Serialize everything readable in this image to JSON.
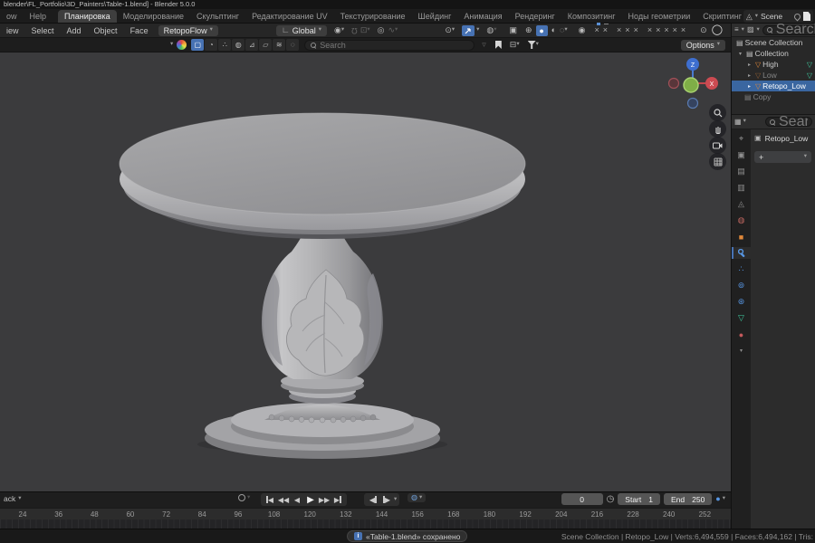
{
  "titlebar": {
    "title": "blender\\FL_Portfolio\\3D_Painters\\Table-1.blend] - Blender 5.0.0"
  },
  "menubar": {
    "window_menu": "ow",
    "help_menu": "Help",
    "tabs": [
      {
        "label": "Планировка"
      },
      {
        "label": "Моделирование"
      },
      {
        "label": "Скульптинг"
      },
      {
        "label": "Редактирование UV"
      },
      {
        "label": "Текстурирование"
      },
      {
        "label": "Шейдинг"
      },
      {
        "label": "Анимация"
      },
      {
        "label": "Рендеринг"
      },
      {
        "label": "Композитинг"
      },
      {
        "label": "Ноды геометрии"
      },
      {
        "label": "Скриптинг"
      },
      {
        "label": "+"
      }
    ],
    "scene_name": "Scene"
  },
  "toolbar": {
    "menus": [
      "iew",
      "Select",
      "Add",
      "Object",
      "Face"
    ],
    "active_tool": "RetopoFlow",
    "orientation": "Global"
  },
  "viewport": {
    "search_placeholder": "Search",
    "options_label": "Options",
    "axis_x": "X",
    "axis_z": "Z"
  },
  "outliner": {
    "search_placeholder": "Search",
    "items": [
      {
        "label": "Scene Collection"
      },
      {
        "label": "Collection"
      },
      {
        "label": "High"
      },
      {
        "label": "Low"
      },
      {
        "label": "Retopo_Low",
        "selected": true
      },
      {
        "label": "Copy"
      }
    ]
  },
  "properties": {
    "search_placeholder": "Search",
    "breadcrumb": "Retopo_Low",
    "add_modifier_label": "+"
  },
  "timeline": {
    "playback_menu": "ack",
    "current_frame": "0",
    "start_label": "Start",
    "start_value": "1",
    "end_label": "End",
    "end_value": "250",
    "ruler": [
      24,
      36,
      48,
      60,
      72,
      84,
      96,
      108,
      120,
      132,
      144,
      156,
      168,
      180,
      192,
      204,
      216,
      228,
      240,
      252
    ]
  },
  "statusbar": {
    "saved_message": "«Table-1.blend» сохранено",
    "stats": "Scene Collection | Retopo_Low | Verts:6,494,559 | Faces:6,494,162 | Tris:"
  },
  "colors": {
    "accent": "#4772b3",
    "selection": "#3a66a0",
    "object_orange": "#e0883a",
    "mesh_green": "#3ec89d",
    "viewport_bg": "#3b3b3d"
  }
}
